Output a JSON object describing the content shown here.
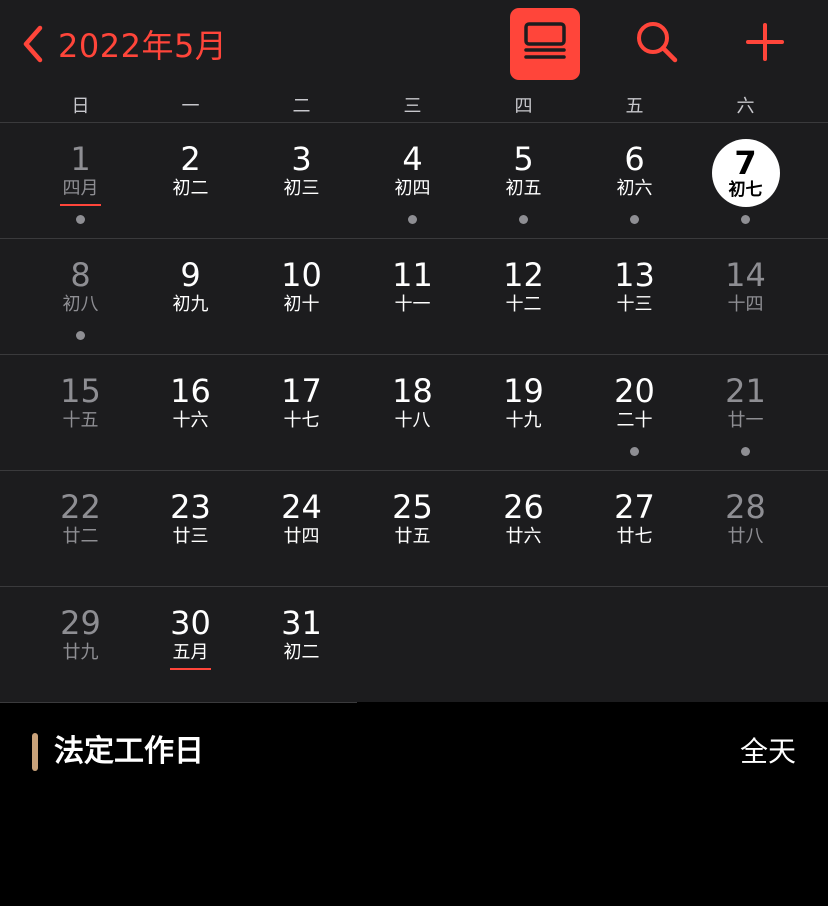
{
  "header": {
    "back_title": "2022年5月",
    "accent": "#ff453a",
    "icons": [
      "chevron-left-icon",
      "list-view-icon",
      "search-icon",
      "plus-icon"
    ]
  },
  "weekdays": [
    "日",
    "一",
    "二",
    "三",
    "四",
    "五",
    "六"
  ],
  "weeks": [
    [
      {
        "day": "1",
        "lunar": "四月",
        "dim": true,
        "underline": true,
        "dot": true
      },
      {
        "day": "2",
        "lunar": "初二"
      },
      {
        "day": "3",
        "lunar": "初三"
      },
      {
        "day": "4",
        "lunar": "初四",
        "dot": true
      },
      {
        "day": "5",
        "lunar": "初五",
        "dot": true
      },
      {
        "day": "6",
        "lunar": "初六",
        "dot": true
      },
      {
        "day": "7",
        "lunar": "初七",
        "today": true,
        "dot": true
      }
    ],
    [
      {
        "day": "8",
        "lunar": "初八",
        "dim": true,
        "dot": true
      },
      {
        "day": "9",
        "lunar": "初九"
      },
      {
        "day": "10",
        "lunar": "初十"
      },
      {
        "day": "11",
        "lunar": "十一"
      },
      {
        "day": "12",
        "lunar": "十二"
      },
      {
        "day": "13",
        "lunar": "十三"
      },
      {
        "day": "14",
        "lunar": "十四",
        "dim": true
      }
    ],
    [
      {
        "day": "15",
        "lunar": "十五",
        "dim": true
      },
      {
        "day": "16",
        "lunar": "十六"
      },
      {
        "day": "17",
        "lunar": "十七"
      },
      {
        "day": "18",
        "lunar": "十八"
      },
      {
        "day": "19",
        "lunar": "十九"
      },
      {
        "day": "20",
        "lunar": "二十",
        "dot": true
      },
      {
        "day": "21",
        "lunar": "廿一",
        "dim": true,
        "dot": true
      }
    ],
    [
      {
        "day": "22",
        "lunar": "廿二",
        "dim": true
      },
      {
        "day": "23",
        "lunar": "廿三"
      },
      {
        "day": "24",
        "lunar": "廿四"
      },
      {
        "day": "25",
        "lunar": "廿五"
      },
      {
        "day": "26",
        "lunar": "廿六"
      },
      {
        "day": "27",
        "lunar": "廿七"
      },
      {
        "day": "28",
        "lunar": "廿八",
        "dim": true
      }
    ],
    [
      {
        "day": "29",
        "lunar": "廿九",
        "dim": true
      },
      {
        "day": "30",
        "lunar": "五月",
        "underline": true
      },
      {
        "day": "31",
        "lunar": "初二"
      }
    ]
  ],
  "event": {
    "name": "法定工作日",
    "time": "全天",
    "color": "#c9a27a"
  }
}
